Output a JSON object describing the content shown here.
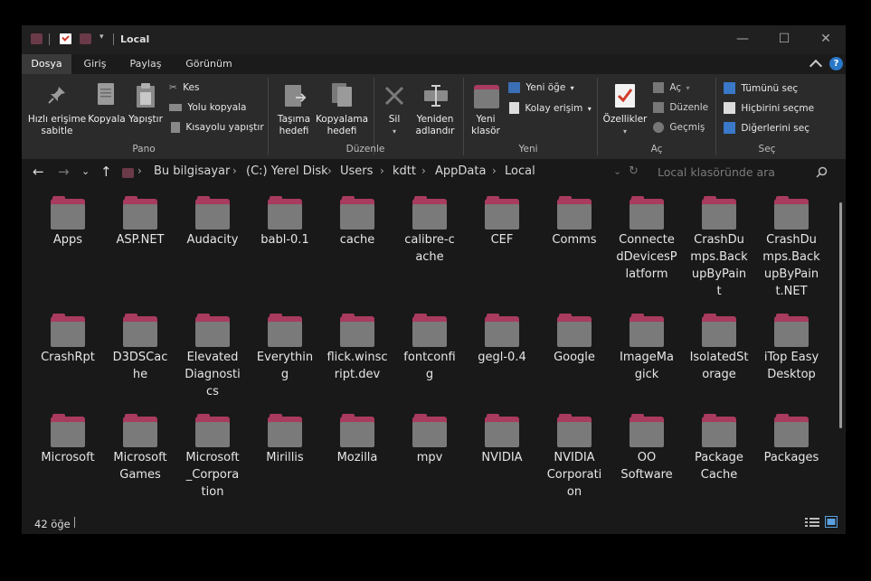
{
  "window": {
    "title": "Local",
    "minimize": "—",
    "maximize": "☐",
    "close": "✕"
  },
  "menu": {
    "tabs": [
      "Dosya",
      "Giriş",
      "Paylaş",
      "Görünüm"
    ],
    "help": "?"
  },
  "ribbon": {
    "pano": {
      "label": "Pano",
      "pin": [
        "Hızlı erişime",
        "sabitle"
      ],
      "copy": "Kopyala",
      "paste": "Yapıştır",
      "cut": "Kes",
      "copy_path": "Yolu kopyala",
      "paste_shortcut": "Kısayolu yapıştır"
    },
    "duzenle": {
      "label": "Düzenle",
      "move_to": [
        "Taşıma",
        "hedefi"
      ],
      "copy_to": [
        "Kopyalama",
        "hedefi"
      ],
      "delete": "Sil",
      "rename": [
        "Yeniden",
        "adlandır"
      ]
    },
    "yeni": {
      "label": "Yeni",
      "new_folder": [
        "Yeni",
        "klasör"
      ],
      "new_item": "Yeni öğe",
      "easy_access": "Kolay erişim"
    },
    "ac": {
      "label": "Aç",
      "properties": "Özellikler",
      "open": "Aç",
      "edit": "Düzenle",
      "history": "Geçmiş"
    },
    "sec": {
      "label": "Seç",
      "select_all": "Tümünü seç",
      "select_none": "Hiçbirini seçme",
      "invert": "Diğerlerini seç"
    }
  },
  "address": {
    "crumbs": [
      "Bu bilgisayar",
      "(C:) Yerel Disk",
      "Users",
      "kdtt",
      "AppData",
      "Local"
    ],
    "search_placeholder": "Local klasöründe ara"
  },
  "items": [
    [
      "Apps"
    ],
    [
      "ASP.NET"
    ],
    [
      "Audacity"
    ],
    [
      "babl-0.1"
    ],
    [
      "cache"
    ],
    [
      "calibre-c",
      "ache"
    ],
    [
      "CEF"
    ],
    [
      "Comms"
    ],
    [
      "Connecte",
      "dDevicesP",
      "latform"
    ],
    [
      "CrashDu",
      "mps.Back",
      "upByPain",
      "t"
    ],
    [
      "CrashDu",
      "mps.Back",
      "upByPain",
      "t.NET"
    ],
    [
      "CrashRpt"
    ],
    [
      "D3DSCac",
      "he"
    ],
    [
      "Elevated",
      "Diagnosti",
      "cs"
    ],
    [
      "Everythin",
      "g"
    ],
    [
      "flick.winsc",
      "ript.dev"
    ],
    [
      "fontconfi",
      "g"
    ],
    [
      "gegl-0.4"
    ],
    [
      "Google"
    ],
    [
      "ImageMa",
      "gick"
    ],
    [
      "IsolatedSt",
      "orage"
    ],
    [
      "iTop Easy",
      "Desktop"
    ],
    [
      "Microsoft"
    ],
    [
      "Microsoft",
      "Games"
    ],
    [
      "Microsoft",
      "_Corpora",
      "tion"
    ],
    [
      "Mirillis"
    ],
    [
      "Mozilla"
    ],
    [
      "mpv"
    ],
    [
      "NVIDIA"
    ],
    [
      "NVIDIA",
      "Corporati",
      "on"
    ],
    [
      "OO",
      "Software"
    ],
    [
      "Package",
      "Cache"
    ],
    [
      "Packages"
    ]
  ],
  "status": {
    "count": "42 öğe"
  }
}
